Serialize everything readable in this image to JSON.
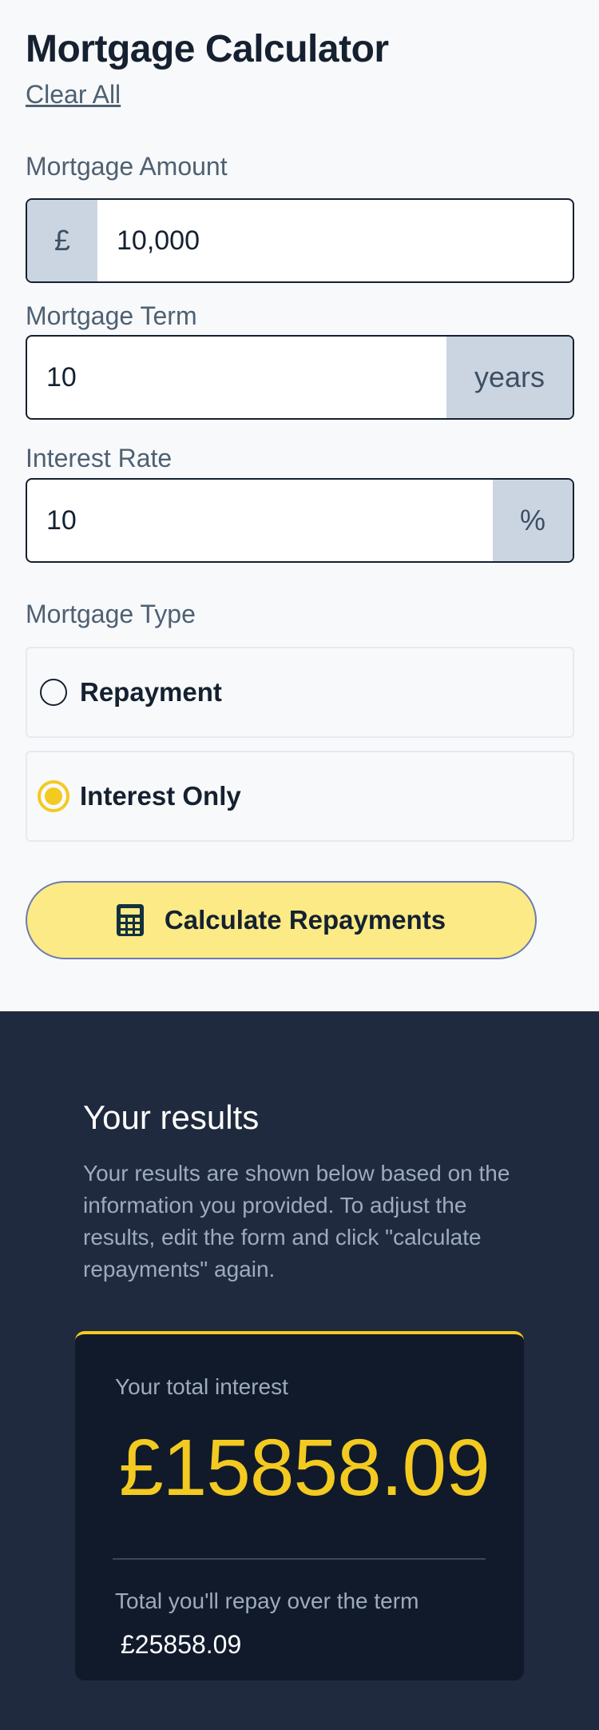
{
  "header": {
    "title": "Mortgage Calculator",
    "clear_all": "Clear All"
  },
  "form": {
    "amount": {
      "label": "Mortgage Amount",
      "prefix": "£",
      "value": "10,000"
    },
    "term": {
      "label": "Mortgage Term",
      "value": "10",
      "suffix": "years"
    },
    "rate": {
      "label": "Interest Rate",
      "value": "10",
      "suffix": "%"
    },
    "type": {
      "label": "Mortgage Type",
      "options": [
        {
          "label": "Repayment",
          "selected": false
        },
        {
          "label": "Interest Only",
          "selected": true
        }
      ]
    },
    "submit_label": "Calculate Repayments"
  },
  "results": {
    "title": "Your results",
    "description": "Your results are shown below based on the information you provided. To adjust the results, edit the form and click \"calculate repayments\" again.",
    "interest_label": "Your total interest",
    "interest_value": "£15858.09",
    "total_label": "Total you'll repay over the term",
    "total_value": "£25858.09"
  },
  "colors": {
    "accent": "#f3ca20",
    "dark_panel": "#1f2a3e",
    "card": "#111a2b"
  }
}
